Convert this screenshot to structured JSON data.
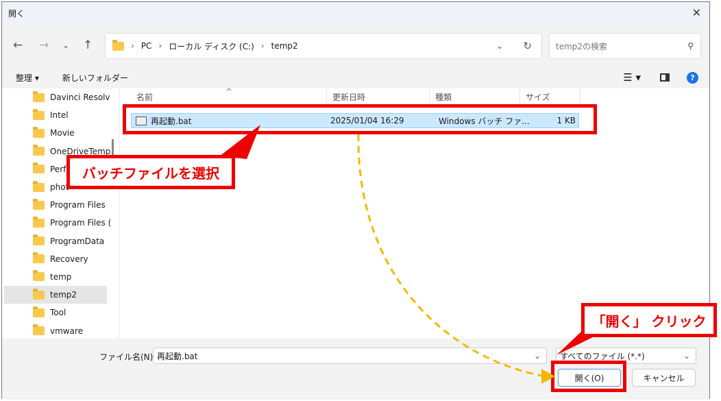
{
  "window": {
    "title": "開く"
  },
  "nav": {
    "breadcrumb": [
      "PC",
      "ローカル ディスク (C:)",
      "temp2"
    ],
    "search_placeholder": "temp2の検索"
  },
  "toolbar": {
    "organize": "整理 ▾",
    "new_folder": "新しいフォルダー"
  },
  "sidebar": {
    "items": [
      "Davinci Resolv",
      "Intel",
      "Movie",
      "OneDriveTemp",
      "Perf",
      "phot",
      "Program Files",
      "Program Files (",
      "ProgramData",
      "Recovery",
      "temp",
      "temp2",
      "Tool",
      "vmware"
    ],
    "selected": "temp2"
  },
  "columns": [
    "名前",
    "更新日時",
    "種類",
    "サイズ"
  ],
  "files": [
    {
      "name": "再起動.bat",
      "date": "2025/01/04 16:29",
      "type": "Windows バッチ ファ...",
      "size": "1 KB"
    }
  ],
  "bottom": {
    "filename_label": "ファイル名(N):",
    "filename_value": "再起動.bat",
    "filetype": "すべてのファイル (*.*)",
    "open": "開く(O)",
    "cancel": "キャンセル"
  },
  "annotations": {
    "select": "バッチファイルを選択",
    "click": "「開く」 クリック"
  },
  "colors": {
    "annotation": "#ee0000",
    "arrow": "#f5b800",
    "selection": "#cce8ff"
  }
}
